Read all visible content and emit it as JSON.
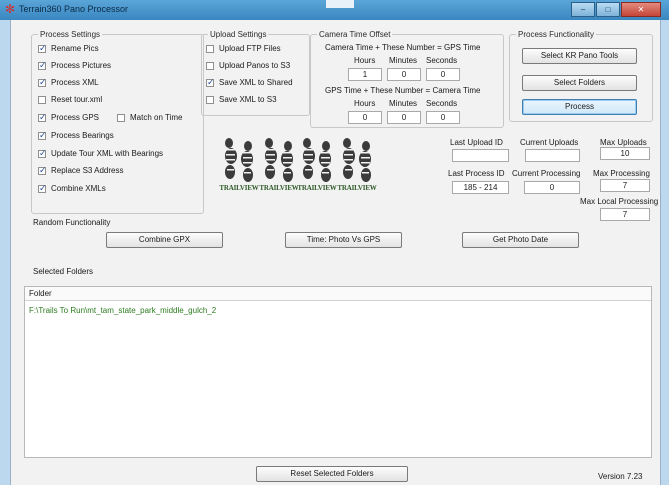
{
  "window": {
    "title": "Terrain360 Pano Processor",
    "minimize": "–",
    "maximize": "□",
    "close": "✕"
  },
  "process_settings": {
    "title": "Process Settings",
    "items": [
      {
        "label": "Rename Pics",
        "checked": true
      },
      {
        "label": "Process Pictures",
        "checked": true
      },
      {
        "label": "Process XML",
        "checked": true
      },
      {
        "label": "Reset tour.xml",
        "checked": false
      },
      {
        "label": "Process GPS",
        "checked": true
      },
      {
        "label": "Process Bearings",
        "checked": true
      },
      {
        "label": "Update Tour XML with Bearings",
        "checked": true
      },
      {
        "label": "Replace S3 Address",
        "checked": true
      },
      {
        "label": "Combine XMLs",
        "checked": true
      }
    ],
    "match_on_time": {
      "label": "Match on Time",
      "checked": false
    }
  },
  "upload_settings": {
    "title": "Upload Settings",
    "items": [
      {
        "label": "Upload FTP Files",
        "checked": false
      },
      {
        "label": "Upload Panos to S3",
        "checked": false
      },
      {
        "label": "Save XML to Shared",
        "checked": true
      },
      {
        "label": "Save XML to S3",
        "checked": false
      }
    ]
  },
  "camera_offset": {
    "title": "Camera Time Offset",
    "row1_caption": "Camera Time + These Number = GPS Time",
    "row2_caption": "GPS Time + These Number = Camera Time",
    "col_hours": "Hours",
    "col_minutes": "Minutes",
    "col_seconds": "Seconds",
    "row1_values": [
      "1",
      "0",
      "0"
    ],
    "row2_values": [
      "0",
      "0",
      "0"
    ]
  },
  "process_functionality": {
    "title": "Process Functionality",
    "select_kr": "Select KR Pano Tools",
    "select_folders": "Select Folders",
    "process": "Process"
  },
  "logos": [
    "TRAILVIEW",
    "TRAILVIEW",
    "TRAILVIEW",
    "TRAILVIEW"
  ],
  "status": {
    "last_upload_id_label": "Last Upload ID",
    "last_upload_id_value": "",
    "current_uploads_label": "Current Uploads",
    "current_uploads_value": "",
    "max_uploads_label": "Max Uploads",
    "max_uploads_value": "10",
    "last_process_id_label": "Last Process ID",
    "last_process_id_value": "185 - 214",
    "current_processing_label": "Current Processing",
    "current_processing_value": "0",
    "max_processing_label": "Max Processing",
    "max_processing_value": "7",
    "max_local_processing_label": "Max Local Processing",
    "max_local_processing_value": "7"
  },
  "random_functionality": {
    "title": "Random Functionality",
    "combine_gpx": "Combine GPX",
    "time_photo_vs_gps": "Time: Photo Vs GPS",
    "get_photo_date": "Get Photo Date"
  },
  "selected_folders": {
    "title": "Selected Folders",
    "column": "Folder",
    "rows": [
      "F:\\Trails To Run\\mt_tam_state_park_middle_gulch_2"
    ],
    "reset_button": "Reset Selected Folders"
  },
  "version": "Version 7.23",
  "colors": {
    "title_bar": "#3a86c0",
    "folder_text": "#2c7a1f",
    "logo_green": "#2f5b28"
  }
}
